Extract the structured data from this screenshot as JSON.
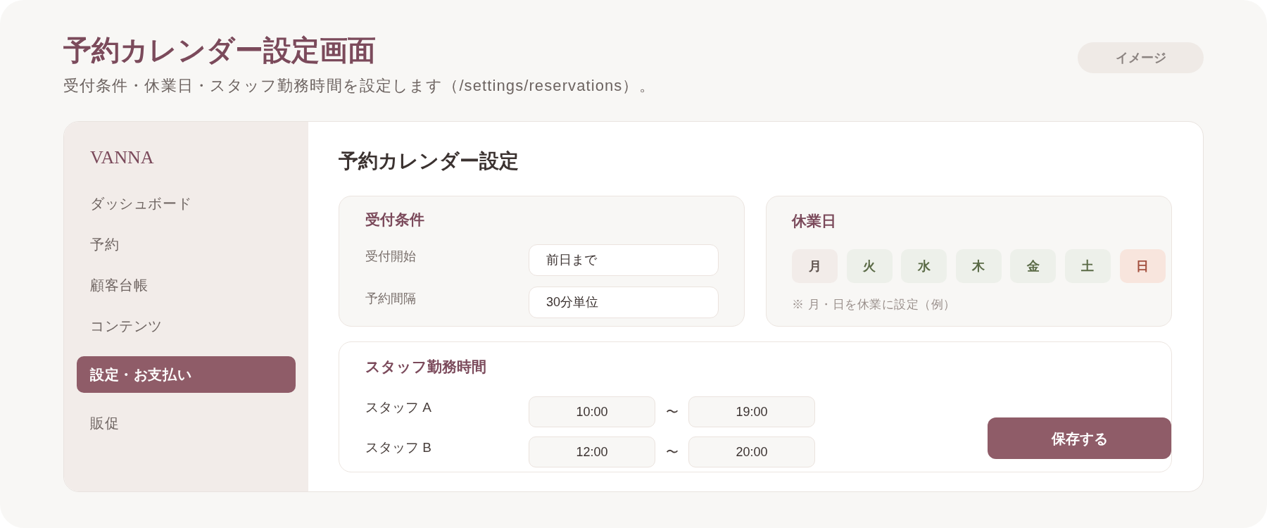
{
  "header": {
    "title": "予約カレンダー設定画面",
    "subtitle": "受付条件・休業日・スタッフ勤務時間を設定します（/settings/reservations）。",
    "badge": "イメージ"
  },
  "sidebar": {
    "logo": "VANNA",
    "items": [
      {
        "label": "ダッシュボード",
        "selected": false
      },
      {
        "label": "予約",
        "selected": false
      },
      {
        "label": "顧客台帳",
        "selected": false
      },
      {
        "label": "コンテンツ",
        "selected": false
      },
      {
        "label": "設定・お支払い",
        "selected": true
      },
      {
        "label": "販促",
        "selected": false
      }
    ]
  },
  "main": {
    "title": "予約カレンダー設定",
    "reception": {
      "title": "受付条件",
      "fields": [
        {
          "label": "受付開始",
          "value": "前日まで"
        },
        {
          "label": "予約間隔",
          "value": "30分単位"
        }
      ]
    },
    "closed_days": {
      "title": "休業日",
      "days": [
        {
          "label": "月",
          "kind": "closed"
        },
        {
          "label": "火",
          "kind": "open"
        },
        {
          "label": "水",
          "kind": "open"
        },
        {
          "label": "木",
          "kind": "open"
        },
        {
          "label": "金",
          "kind": "open"
        },
        {
          "label": "土",
          "kind": "open"
        },
        {
          "label": "日",
          "kind": "holiday"
        }
      ],
      "note": "※ 月・日を休業に設定（例）"
    },
    "staff_hours": {
      "title": "スタッフ勤務時間",
      "rows": [
        {
          "name": "スタッフ A",
          "start": "10:00",
          "separator": "〜",
          "end": "19:00"
        },
        {
          "name": "スタッフ B",
          "start": "12:00",
          "separator": "〜",
          "end": "20:00"
        }
      ]
    },
    "save_button": "保存する"
  }
}
